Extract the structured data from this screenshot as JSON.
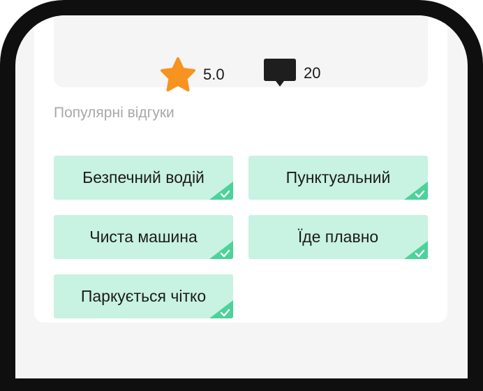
{
  "stats": {
    "rating": {
      "icon": "star-icon",
      "value": "5.0",
      "color": "#f7931e"
    },
    "reviews": {
      "icon": "comment-icon",
      "value": "20",
      "color": "#1e1e1e"
    }
  },
  "popular_reviews": {
    "title": "Популярні відгуки",
    "tags": [
      {
        "label": "Безпечний водій",
        "selected": true
      },
      {
        "label": "Пунктуальний",
        "selected": true
      },
      {
        "label": "Чиста машина",
        "selected": true
      },
      {
        "label": "Їде плавно",
        "selected": true
      },
      {
        "label": "Паркується чітко",
        "selected": true
      }
    ]
  },
  "colors": {
    "tag_background": "#c8f2e2",
    "check_accent": "#4bd39a",
    "frame": "#0f0f0f"
  }
}
